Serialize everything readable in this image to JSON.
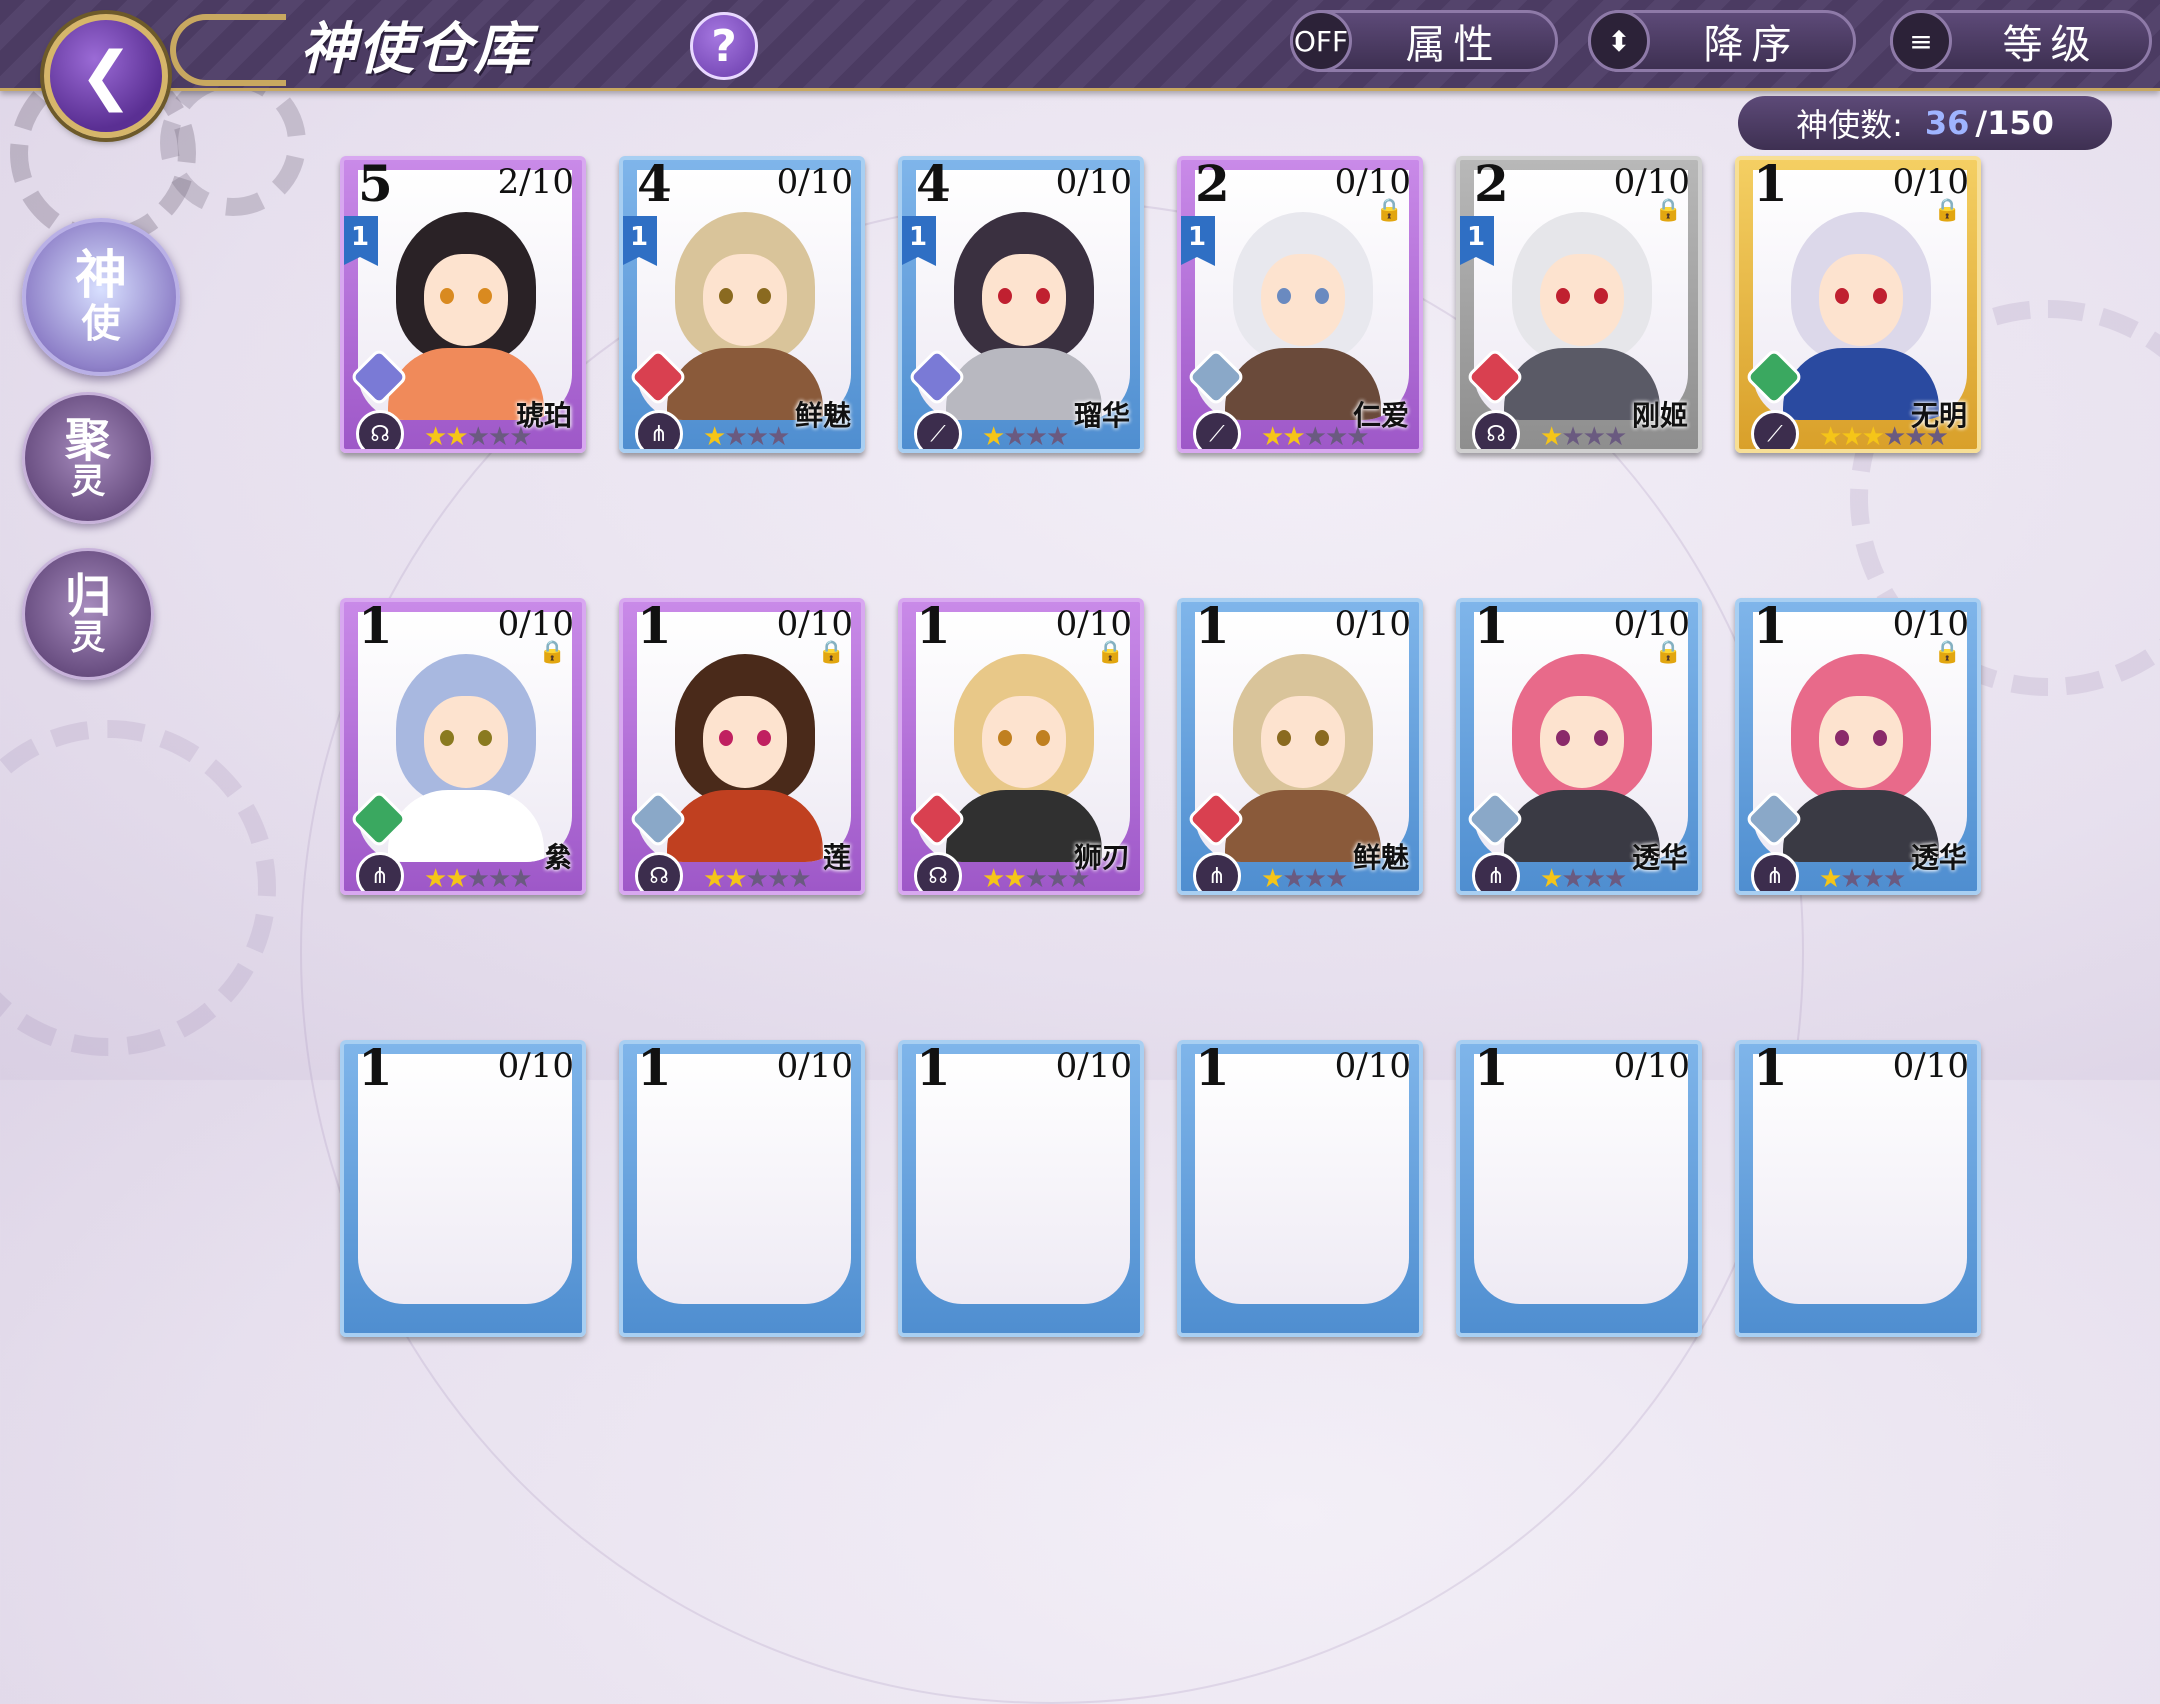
{
  "header": {
    "title": "神使仓库",
    "help_symbol": "?",
    "attr_toggle": "OFF",
    "attr_label": "属性",
    "sort_label": "降序",
    "level_label": "等级"
  },
  "counter": {
    "label": "神使数:",
    "current": "36",
    "total": "/150"
  },
  "side_menu": [
    {
      "top": "神",
      "bottom": "使",
      "active": true
    },
    {
      "top": "聚",
      "bottom": "灵",
      "active": false
    },
    {
      "top": "归",
      "bottom": "灵",
      "active": false
    }
  ],
  "cards": [
    {
      "count": "5",
      "fragments": "2/10",
      "name": "琥珀",
      "frame": "purple",
      "level_badge": "1",
      "locked": false,
      "element_color": "#7a7ad6",
      "class_icon": "helmet-icon",
      "stars": 2,
      "max_stars": 5,
      "hair": "#2a2226",
      "outfit": "#f08a5a",
      "eyes": "#d98a20"
    },
    {
      "count": "4",
      "fragments": "0/10",
      "name": "鲜魅",
      "frame": "blue",
      "level_badge": "1",
      "locked": false,
      "element_color": "#d94050",
      "class_icon": "claw-icon",
      "stars": 1,
      "max_stars": 4,
      "hair": "#d9c49a",
      "outfit": "#8a5a3a",
      "eyes": "#8a6a20"
    },
    {
      "count": "4",
      "fragments": "0/10",
      "name": "瑠华",
      "frame": "blue",
      "level_badge": "1",
      "locked": false,
      "element_color": "#7a7ad6",
      "class_icon": "blade-icon",
      "stars": 1,
      "max_stars": 4,
      "hair": "#3a3040",
      "outfit": "#b8b8c0",
      "eyes": "#c02030"
    },
    {
      "count": "2",
      "fragments": "0/10",
      "name": "仁爱",
      "frame": "purple",
      "level_badge": "1",
      "locked": true,
      "element_color": "#8aa8c8",
      "class_icon": "blade-icon",
      "stars": 2,
      "max_stars": 5,
      "hair": "#e8e8ee",
      "outfit": "#6a4a3a",
      "eyes": "#6a8ac0"
    },
    {
      "count": "2",
      "fragments": "0/10",
      "name": "刚姬",
      "frame": "gray",
      "level_badge": "1",
      "locked": true,
      "element_color": "#d94050",
      "class_icon": "helmet-icon",
      "stars": 1,
      "max_stars": 4,
      "hair": "#e6e6ea",
      "outfit": "#5a5a66",
      "eyes": "#c02030"
    },
    {
      "count": "1",
      "fragments": "0/10",
      "name": "无明",
      "frame": "gold",
      "level_badge": "",
      "locked": true,
      "element_color": "#3aa860",
      "class_icon": "blade-icon",
      "stars": 3,
      "max_stars": 6,
      "hair": "#dcd8ea",
      "outfit": "#2a4aa0",
      "eyes": "#c02030"
    },
    {
      "count": "1",
      "fragments": "0/10",
      "name": "絫",
      "frame": "purple",
      "level_badge": "",
      "locked": true,
      "element_color": "#3aa860",
      "class_icon": "claw-icon",
      "stars": 2,
      "max_stars": 5,
      "hair": "#a8b8e0",
      "outfit": "#ffffff",
      "eyes": "#8a7a20"
    },
    {
      "count": "1",
      "fragments": "0/10",
      "name": "莲",
      "frame": "purple",
      "level_badge": "",
      "locked": true,
      "element_color": "#8aa8c8",
      "class_icon": "helmet-icon",
      "stars": 2,
      "max_stars": 5,
      "hair": "#4a2a1a",
      "outfit": "#c04020",
      "eyes": "#c02060"
    },
    {
      "count": "1",
      "fragments": "0/10",
      "name": "狮刃",
      "frame": "purple",
      "level_badge": "",
      "locked": true,
      "element_color": "#d94050",
      "class_icon": "helmet-icon",
      "stars": 2,
      "max_stars": 5,
      "hair": "#e8c888",
      "outfit": "#303030",
      "eyes": "#c08020"
    },
    {
      "count": "1",
      "fragments": "0/10",
      "name": "鲜魅",
      "frame": "blue",
      "level_badge": "",
      "locked": false,
      "element_color": "#d94050",
      "class_icon": "claw-icon",
      "stars": 1,
      "max_stars": 4,
      "hair": "#d9c49a",
      "outfit": "#8a5a3a",
      "eyes": "#8a6a20"
    },
    {
      "count": "1",
      "fragments": "0/10",
      "name": "透华",
      "frame": "blue",
      "level_badge": "",
      "locked": true,
      "element_color": "#8aa8c8",
      "class_icon": "claw-icon",
      "stars": 1,
      "max_stars": 4,
      "hair": "#e86a8a",
      "outfit": "#3a3a44",
      "eyes": "#8a2a6a"
    },
    {
      "count": "1",
      "fragments": "0/10",
      "name": "透华",
      "frame": "blue",
      "level_badge": "",
      "locked": true,
      "element_color": "#8aa8c8",
      "class_icon": "claw-icon",
      "stars": 1,
      "max_stars": 4,
      "hair": "#e86a8a",
      "outfit": "#3a3a44",
      "eyes": "#8a2a6a"
    },
    {
      "count": "1",
      "fragments": "0/10",
      "frame": "blue"
    },
    {
      "count": "1",
      "fragments": "0/10",
      "frame": "blue"
    },
    {
      "count": "1",
      "fragments": "0/10",
      "frame": "blue"
    },
    {
      "count": "1",
      "fragments": "0/10",
      "frame": "blue"
    },
    {
      "count": "1",
      "fragments": "0/10",
      "frame": "blue"
    },
    {
      "count": "1",
      "fragments": "0/10",
      "frame": "blue"
    }
  ]
}
